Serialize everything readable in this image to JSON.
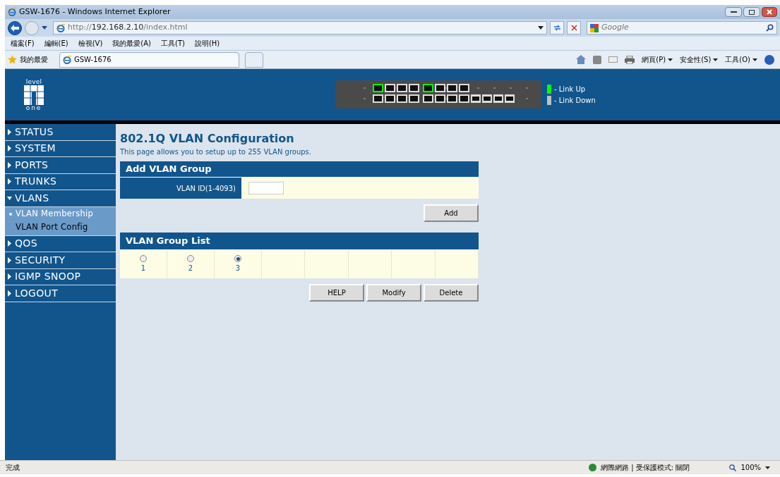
{
  "window": {
    "title": "GSW-1676 - Windows Internet Explorer"
  },
  "address_bar": {
    "url_prefix": "http://",
    "url_host": "192.168.2.10",
    "url_path": "/index.html"
  },
  "search": {
    "placeholder": "Google"
  },
  "menu": [
    "檔案(F)",
    "編輯(E)",
    "檢視(V)",
    "我的最愛(A)",
    "工具(T)",
    "說明(H)"
  ],
  "favorites": {
    "label": "我的最愛"
  },
  "tabs": [
    {
      "label": "GSW-1676",
      "selected": true
    }
  ],
  "command_bar": [
    "網頁(P)",
    "安全性(S)",
    "工具(O)"
  ],
  "banner": {
    "logo_top": "level",
    "logo_bottom": "one",
    "legend": [
      {
        "label": "- Link Up",
        "color": "#00ff00"
      },
      {
        "label": "- Link Down",
        "color": "#c0c0c0"
      }
    ]
  },
  "sidebar": [
    {
      "label": "STATUS",
      "expanded": false
    },
    {
      "label": "SYSTEM",
      "expanded": false
    },
    {
      "label": "PORTS",
      "expanded": false
    },
    {
      "label": "TRUNKS",
      "expanded": false
    },
    {
      "label": "VLANS",
      "expanded": true,
      "children": [
        {
          "label": "VLAN Membership",
          "selected": true
        },
        {
          "label": "VLAN Port Config",
          "selected": false
        }
      ]
    },
    {
      "label": "QOS",
      "expanded": false
    },
    {
      "label": "SECURITY",
      "expanded": false
    },
    {
      "label": "IGMP SNOOP",
      "expanded": false
    },
    {
      "label": "LOGOUT",
      "expanded": false
    }
  ],
  "page": {
    "title": "802.1Q VLAN Configuration",
    "description": "This page allows you to setup up to 255 VLAN groups."
  },
  "add_group": {
    "header": "Add VLAN Group",
    "label": "VLAN ID(1-4093)",
    "button": "Add"
  },
  "group_list": {
    "header": "VLAN Group List",
    "groups": [
      {
        "label": "1",
        "selected": false
      },
      {
        "label": "2",
        "selected": false
      },
      {
        "label": "3",
        "selected": true
      }
    ],
    "buttons": [
      "HELP",
      "Modify",
      "Delete"
    ]
  },
  "status_bar": {
    "text": "完成",
    "zone": "網際網路 | 受保護模式: 關閉",
    "zoom": "100%"
  }
}
